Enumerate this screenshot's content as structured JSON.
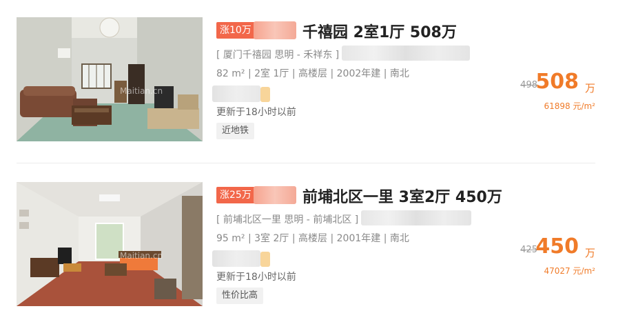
{
  "listings": [
    {
      "rise_tag": "涨10万",
      "title": "千禧园 2室1厅 508万",
      "address": "[ 厦门千禧园 思明 - 禾祥东 ]",
      "info": "82 m² | 2室 1厅 | 高楼层 | 2002年建 | 南北",
      "updated": "更新于18小时以前",
      "badge": "近地铁",
      "old_price": "498",
      "price": "508",
      "price_unit": "万",
      "unit_price": "61898 元/m²",
      "watermark": "Maitian.cn"
    },
    {
      "rise_tag": "涨25万",
      "title": "前埔北区一里 3室2厅 450万",
      "address": "[ 前埔北区一里 思明 - 前埔北区 ]",
      "info": "95 m² | 3室 2厅 | 高楼层 | 2001年建 | 南北",
      "updated": "更新于18小时以前",
      "badge": "性价比高",
      "old_price": "425",
      "price": "450",
      "price_unit": "万",
      "unit_price": "47027 元/m²",
      "watermark": "Maitian.cn"
    }
  ],
  "colors": {
    "accent": "#f07b29",
    "rise_tag": "#f2674a"
  }
}
